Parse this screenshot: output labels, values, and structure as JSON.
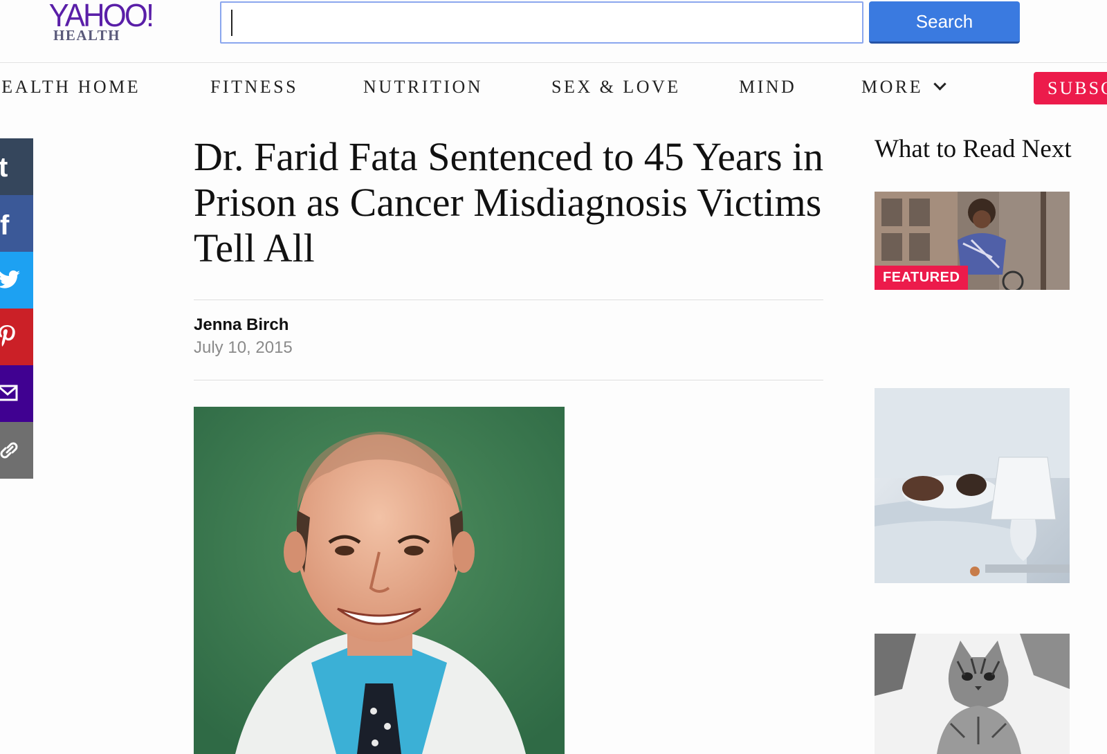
{
  "header": {
    "logo_brand": "YAHOO!",
    "logo_sub": "HEALTH",
    "search_value": "",
    "search_button": "Search"
  },
  "nav": {
    "items": [
      "HEALTH HOME",
      "FITNESS",
      "NUTRITION",
      "SEX & LOVE",
      "MIND",
      "MORE"
    ],
    "subscribe": "SUBSCRIBE"
  },
  "share": {
    "buttons": [
      "tumblr-icon",
      "facebook-icon",
      "twitter-icon",
      "pinterest-icon",
      "email-icon",
      "link-icon"
    ],
    "colors": [
      "#35465c",
      "#3b5998",
      "#1da1f2",
      "#cb2027",
      "#400191",
      "#6f6f6f"
    ]
  },
  "article": {
    "headline": "Dr. Farid Fata Sentenced to 45 Years in Prison as Cancer Misdiagnosis Victims Tell All",
    "author": "Jenna Birch",
    "date": "July 10, 2015"
  },
  "sidebar": {
    "title": "What to Read Next",
    "featured_label": "FEATURED"
  },
  "colors": {
    "brand_purple": "#5a1fa8",
    "search_blue": "#3a7ae0",
    "accent_pink": "#ec1b4b"
  }
}
